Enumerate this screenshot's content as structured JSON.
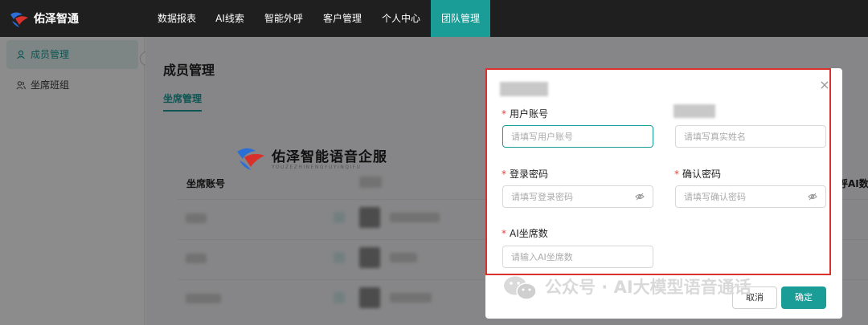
{
  "app": {
    "brand": "佑泽智通"
  },
  "nav": {
    "items": [
      {
        "label": "数据报表"
      },
      {
        "label": "AI线索"
      },
      {
        "label": "智能外呼"
      },
      {
        "label": "客户管理"
      },
      {
        "label": "个人中心"
      },
      {
        "label": "团队管理",
        "active": true
      }
    ]
  },
  "sidebar": {
    "items": [
      {
        "label": "成员管理",
        "active": true,
        "icon": "user-icon"
      },
      {
        "label": "坐席班组",
        "active": false,
        "icon": "group-icon"
      }
    ],
    "collapse_glyph": "‹"
  },
  "main": {
    "title": "成员管理",
    "tab": "坐席管理",
    "columns": {
      "seat_account": "坐席账号",
      "right_partial": "呼AI数"
    }
  },
  "modal": {
    "close_glyph": "×",
    "fields": {
      "user_account": {
        "label": "用户账号",
        "placeholder": "请填写用户账号"
      },
      "real_name": {
        "placeholder": "请填写真实姓名"
      },
      "login_password": {
        "label": "登录密码",
        "placeholder": "请填写登录密码"
      },
      "confirm_password": {
        "label": "确认密码",
        "placeholder": "请填写确认密码"
      },
      "ai_seats": {
        "label": "AI坐席数",
        "placeholder": "请输入AI坐席数"
      }
    },
    "required_mark": "*",
    "buttons": {
      "cancel": "取消",
      "ok": "确定"
    }
  },
  "watermarks": {
    "logo_text": "佑泽智能语音企服",
    "logo_sub": "YOUZEZHINENGYUYINQIFU",
    "wechat": "公众号 · AI大模型语音通话"
  },
  "colors": {
    "accent": "#1a9c97",
    "nav_bg": "#1f1f1f",
    "required": "#e0443e",
    "highlight_frame": "#d9322f"
  }
}
